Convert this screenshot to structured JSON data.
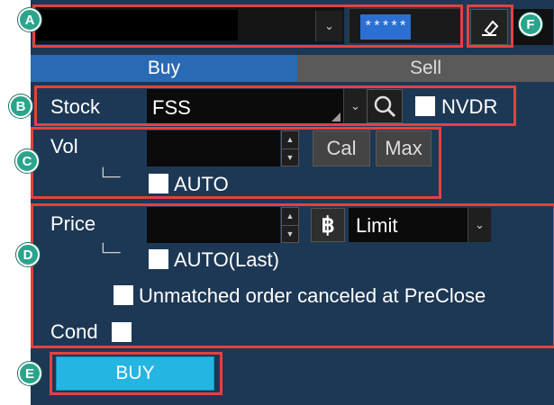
{
  "callouts": {
    "a": "A",
    "b": "B",
    "c": "C",
    "d": "D",
    "e": "E",
    "f": "F"
  },
  "header": {
    "account_value": "",
    "password_masked": "*****"
  },
  "tabs": {
    "buy": "Buy",
    "sell": "Sell"
  },
  "stock": {
    "label": "Stock",
    "value": "FSS",
    "nvdr_label": "NVDR"
  },
  "volume": {
    "label": "Vol",
    "value": "",
    "cal_label": "Cal",
    "max_label": "Max",
    "tree_glyph": "└─",
    "auto_label": "AUTO"
  },
  "price": {
    "label": "Price",
    "value": "",
    "currency_glyph": "฿",
    "order_type": "Limit",
    "tree_glyph": "└─",
    "auto_last_label": "AUTO(Last)",
    "preclose_label": "Unmatched order canceled at PreClose",
    "cond_label": "Cond"
  },
  "action": {
    "buy_label": "BUY"
  },
  "colors": {
    "panel": "#1d3855",
    "tab_active": "#2a6ab4",
    "tab_inactive": "#5a5a5a",
    "buy_button": "#25b5e2",
    "highlight": "#e5413f",
    "callout": "#2aa58c"
  },
  "icons": {
    "dropdown": "chevron-down-icon",
    "search": "search-icon",
    "eraser": "eraser-icon",
    "currency": "baht-icon"
  }
}
